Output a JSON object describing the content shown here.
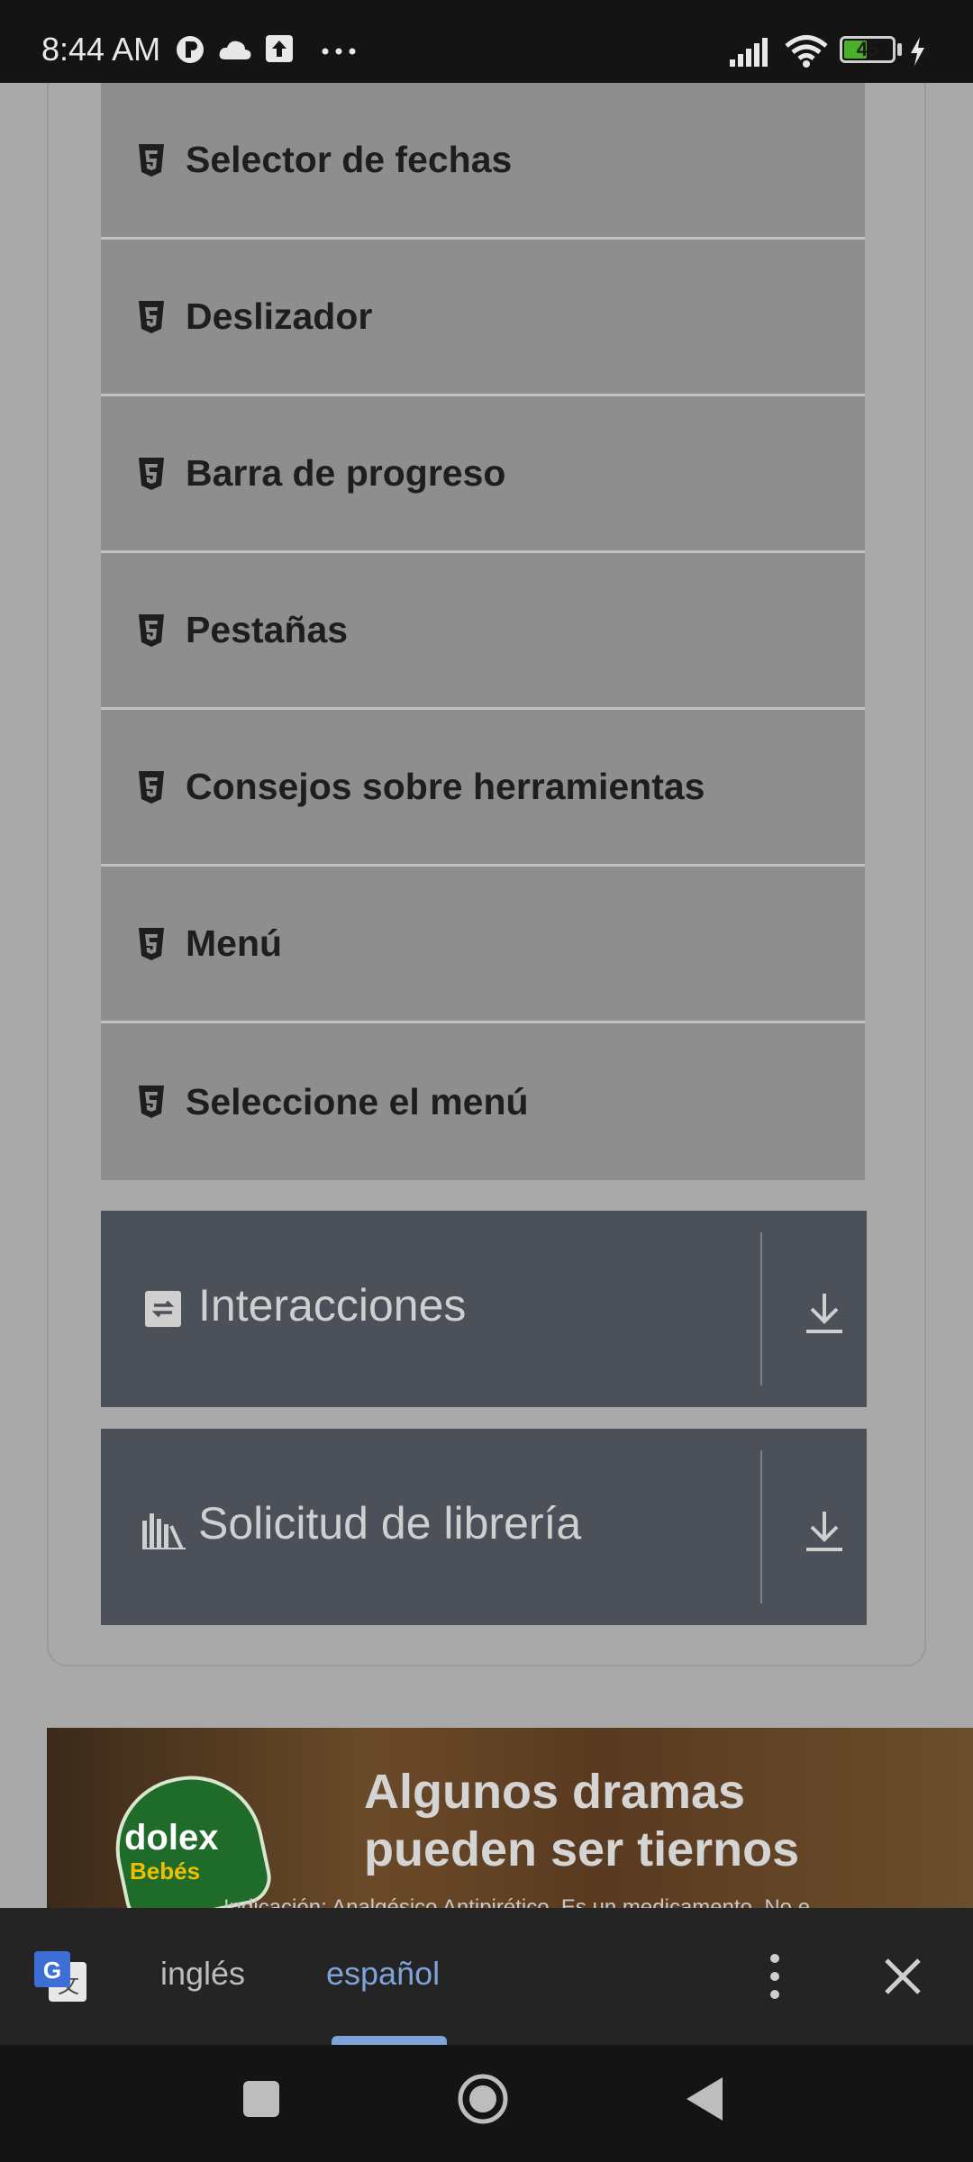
{
  "status_bar": {
    "time": "8:44 AM",
    "battery_level": "45",
    "battery_fraction": 0.45,
    "icons": [
      "notification-p-icon",
      "cloud-icon",
      "upload-icon",
      "more-dots-icon",
      "signal-icon",
      "wifi-icon",
      "battery-icon",
      "charging-icon"
    ]
  },
  "list_items": [
    {
      "label": "Selector de fechas",
      "icon": "html5-icon"
    },
    {
      "label": "Deslizador",
      "icon": "html5-icon"
    },
    {
      "label": "Barra de progreso",
      "icon": "html5-icon"
    },
    {
      "label": "Pestañas",
      "icon": "html5-icon"
    },
    {
      "label": "Consejos sobre herramientas",
      "icon": "html5-icon"
    },
    {
      "label": "Menú",
      "icon": "html5-icon"
    },
    {
      "label": "Seleccione el menú",
      "icon": "html5-icon"
    }
  ],
  "panels": [
    {
      "label": "Interacciones",
      "icon": "interactions-icon",
      "action_icon": "download-icon"
    },
    {
      "label": "Solicitud de librería",
      "icon": "library-icon",
      "action_icon": "download-icon"
    }
  ],
  "ad": {
    "logo_line1": "dolex",
    "logo_line2": "Bebés",
    "headline_line1": "Algunos dramas",
    "headline_line2": "pueden ser tiernos",
    "disclaimer": "Indicación: Analgésico Antipirético. Es un medicamento. No e"
  },
  "translate_bar": {
    "source_lang": "inglés",
    "target_lang": "español",
    "selected": "español"
  },
  "colors": {
    "accent": "#7fa3d8",
    "list_bg": "#8e8e8e",
    "panel_bg": "#4c5058"
  }
}
